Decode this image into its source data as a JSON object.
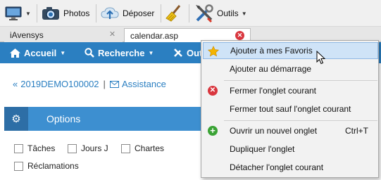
{
  "toolbar": {
    "photos_label": "Photos",
    "deposer_label": "Déposer",
    "outils_label": "Outils"
  },
  "tabs": [
    {
      "label": "iAvensys"
    },
    {
      "label": "calendar.asp"
    }
  ],
  "nav": {
    "accueil": "Accueil",
    "recherche": "Recherche",
    "outils_partial": "Out"
  },
  "breadcrumb": {
    "code": "2019DEMO100002",
    "separator": "|",
    "assistance": "Assistance"
  },
  "panel": {
    "title": "Options",
    "checkboxes": [
      "Tâches",
      "Jours J",
      "Chartes",
      "Réclamations"
    ]
  },
  "context_menu": {
    "items": [
      {
        "label": "Ajouter à mes Favoris",
        "icon": "star-icon"
      },
      {
        "label": "Ajouter au démarrage"
      },
      {
        "label": "Fermer l'onglet courant",
        "icon": "close-circle-icon"
      },
      {
        "label": "Fermer tout sauf l'onglet courant"
      },
      {
        "label": "Ouvrir un nouvel onglet",
        "shortcut": "Ctrl+T",
        "icon": "plus-circle-icon"
      },
      {
        "label": "Dupliquer l'onglet"
      },
      {
        "label": "Détacher l'onglet courant"
      }
    ]
  },
  "colors": {
    "nav_blue": "#2b7fc1",
    "panel_blue": "#3d8fd0",
    "highlight": "#cfe3f7",
    "close_red": "#d9363e",
    "add_green": "#3aa335",
    "star_gold": "#f5b400"
  }
}
